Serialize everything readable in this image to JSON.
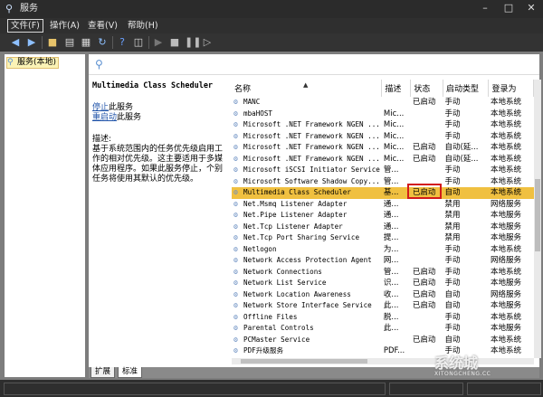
{
  "window": {
    "title": "服务",
    "app_icon": "magnifier-icon"
  },
  "menu": [
    {
      "label": "文件(F)"
    },
    {
      "label": "操作(A)"
    },
    {
      "label": "查看(V)"
    },
    {
      "label": "帮助(H)"
    }
  ],
  "tree": {
    "root_label": "服务(本地)"
  },
  "detail": {
    "service_name": "Multimedia Class Scheduler",
    "stop_link": "停止",
    "stop_suffix": "此服务",
    "restart_link": "重启动",
    "restart_suffix": "此服务",
    "desc_label": "描述:",
    "desc_text": "基于系统范围内的任务优先级启用工作的相对优先级。这主要适用于多媒体应用程序。如果此服务停止，个别任务将使用其默认的优先级。"
  },
  "columns": [
    "名称",
    "描述",
    "状态",
    "启动类型",
    "登录为"
  ],
  "rows": [
    {
      "name": "MANC",
      "desc": "",
      "status": "已启动",
      "startup": "手动",
      "logon": "本地系统"
    },
    {
      "name": "mbaHOST",
      "desc": "Mic...",
      "status": "",
      "startup": "手动",
      "logon": "本地系统"
    },
    {
      "name": "Microsoft .NET Framework NGEN ...",
      "desc": "Mic...",
      "status": "",
      "startup": "手动",
      "logon": "本地系统"
    },
    {
      "name": "Microsoft .NET Framework NGEN ...",
      "desc": "Mic...",
      "status": "",
      "startup": "手动",
      "logon": "本地系统"
    },
    {
      "name": "Microsoft .NET Framework NGEN ...",
      "desc": "Mic...",
      "status": "已启动",
      "startup": "自动(延...",
      "logon": "本地系统"
    },
    {
      "name": "Microsoft .NET Framework NGEN ...",
      "desc": "Mic...",
      "status": "已启动",
      "startup": "自动(延...",
      "logon": "本地系统"
    },
    {
      "name": "Microsoft iSCSI Initiator Service",
      "desc": "管...",
      "status": "",
      "startup": "手动",
      "logon": "本地系统"
    },
    {
      "name": "Microsoft Software Shadow Copy...",
      "desc": "管...",
      "status": "",
      "startup": "手动",
      "logon": "本地系统"
    },
    {
      "name": "Multimedia Class Scheduler",
      "desc": "基...",
      "status": "已启动",
      "startup": "自动",
      "logon": "本地系统",
      "selected": true
    },
    {
      "name": "Net.Msmq Listener Adapter",
      "desc": "通...",
      "status": "",
      "startup": "禁用",
      "logon": "网络服务"
    },
    {
      "name": "Net.Pipe Listener Adapter",
      "desc": "通...",
      "status": "",
      "startup": "禁用",
      "logon": "本地服务"
    },
    {
      "name": "Net.Tcp Listener Adapter",
      "desc": "通...",
      "status": "",
      "startup": "禁用",
      "logon": "本地服务"
    },
    {
      "name": "Net.Tcp Port Sharing Service",
      "desc": "提...",
      "status": "",
      "startup": "禁用",
      "logon": "本地服务"
    },
    {
      "name": "Netlogon",
      "desc": "为...",
      "status": "",
      "startup": "手动",
      "logon": "本地系统"
    },
    {
      "name": "Network Access Protection Agent",
      "desc": "网...",
      "status": "",
      "startup": "手动",
      "logon": "网络服务"
    },
    {
      "name": "Network Connections",
      "desc": "管...",
      "status": "已启动",
      "startup": "手动",
      "logon": "本地系统"
    },
    {
      "name": "Network List Service",
      "desc": "识...",
      "status": "已启动",
      "startup": "手动",
      "logon": "本地服务"
    },
    {
      "name": "Network Location Awareness",
      "desc": "收...",
      "status": "已启动",
      "startup": "自动",
      "logon": "网络服务"
    },
    {
      "name": "Network Store Interface Service",
      "desc": "此...",
      "status": "已启动",
      "startup": "自动",
      "logon": "本地服务"
    },
    {
      "name": "Offline Files",
      "desc": "脱...",
      "status": "",
      "startup": "手动",
      "logon": "本地系统"
    },
    {
      "name": "Parental Controls",
      "desc": "此...",
      "status": "",
      "startup": "手动",
      "logon": "本地服务"
    },
    {
      "name": "PCMaster Service",
      "desc": "",
      "status": "已启动",
      "startup": "自动",
      "logon": "本地系统"
    },
    {
      "name": "PDF升级服务",
      "desc": "PDF...",
      "status": "",
      "startup": "手动",
      "logon": "本地系统"
    }
  ],
  "tabs": [
    "扩展",
    "标准"
  ],
  "colors": {
    "selected_row": "#f0c040",
    "highlight_box": "#d21a1a",
    "link": "#2255aa"
  },
  "watermark": {
    "main": "系统城",
    "sub": "XITONGCHENG.CC"
  }
}
